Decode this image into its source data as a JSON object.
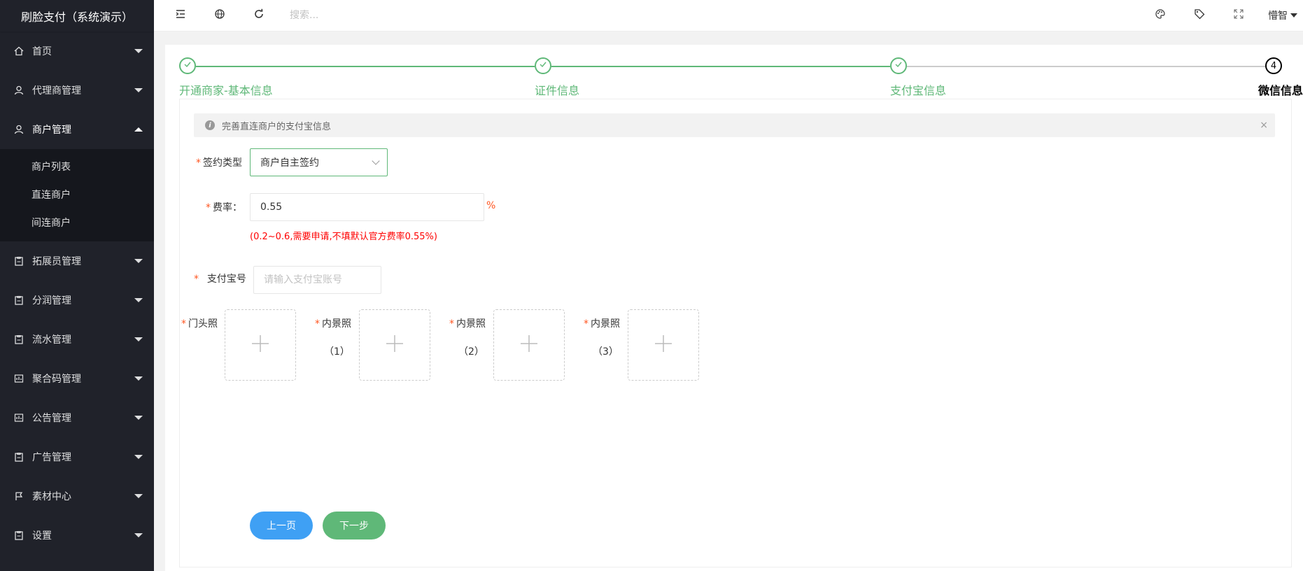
{
  "app": {
    "title": "刷脸支付（系统演示）"
  },
  "sidebar": {
    "items": [
      {
        "label": "首页",
        "icon": "home-icon"
      },
      {
        "label": "代理商管理",
        "icon": "user-icon"
      },
      {
        "label": "商户管理",
        "icon": "user-icon",
        "expanded": true,
        "children": [
          {
            "label": "商户列表"
          },
          {
            "label": "直连商户"
          },
          {
            "label": "间连商户"
          }
        ]
      },
      {
        "label": "拓展员管理",
        "icon": "clipboard-icon"
      },
      {
        "label": "分润管理",
        "icon": "clipboard-icon"
      },
      {
        "label": "流水管理",
        "icon": "clipboard-icon"
      },
      {
        "label": "聚合码管理",
        "icon": "chart-icon"
      },
      {
        "label": "公告管理",
        "icon": "chart-icon"
      },
      {
        "label": "广告管理",
        "icon": "clipboard-icon"
      },
      {
        "label": "素材中心",
        "icon": "flag-icon"
      },
      {
        "label": "设置",
        "icon": "clipboard-icon"
      }
    ]
  },
  "header": {
    "search_placeholder": "搜索...",
    "user_name": "懵智"
  },
  "steps": [
    {
      "label": "开通商家-基本信息",
      "status": "done"
    },
    {
      "label": "证件信息",
      "status": "done"
    },
    {
      "label": "支付宝信息",
      "status": "done"
    },
    {
      "label": "微信信息",
      "status": "current",
      "number": "4"
    }
  ],
  "colors": {
    "accent": "#5fb878",
    "required": "#ff5722",
    "hint": "#ff0000",
    "prev_button": "#3fa0f4"
  },
  "form": {
    "alert_text": "完善直连商户的支付宝信息",
    "alert_close": "×",
    "required_mark": "*",
    "sign_type": {
      "label": "签约类型",
      "value": "商户自主签约"
    },
    "rate": {
      "label": "费率：",
      "value": "0.55",
      "unit": "%",
      "hint": "(0.2~0.6,需要申请,不填默认官方费率0.55%)"
    },
    "alipay_account": {
      "label": "支付宝号",
      "placeholder": "请输入支付宝账号"
    },
    "photos": [
      {
        "label": "门头照",
        "number": ""
      },
      {
        "label": "内景照",
        "number": "（1）"
      },
      {
        "label": "内景照",
        "number": "（2）"
      },
      {
        "label": "内景照",
        "number": "（3）"
      }
    ],
    "prev_button": "上一页",
    "next_button": "下一步"
  }
}
